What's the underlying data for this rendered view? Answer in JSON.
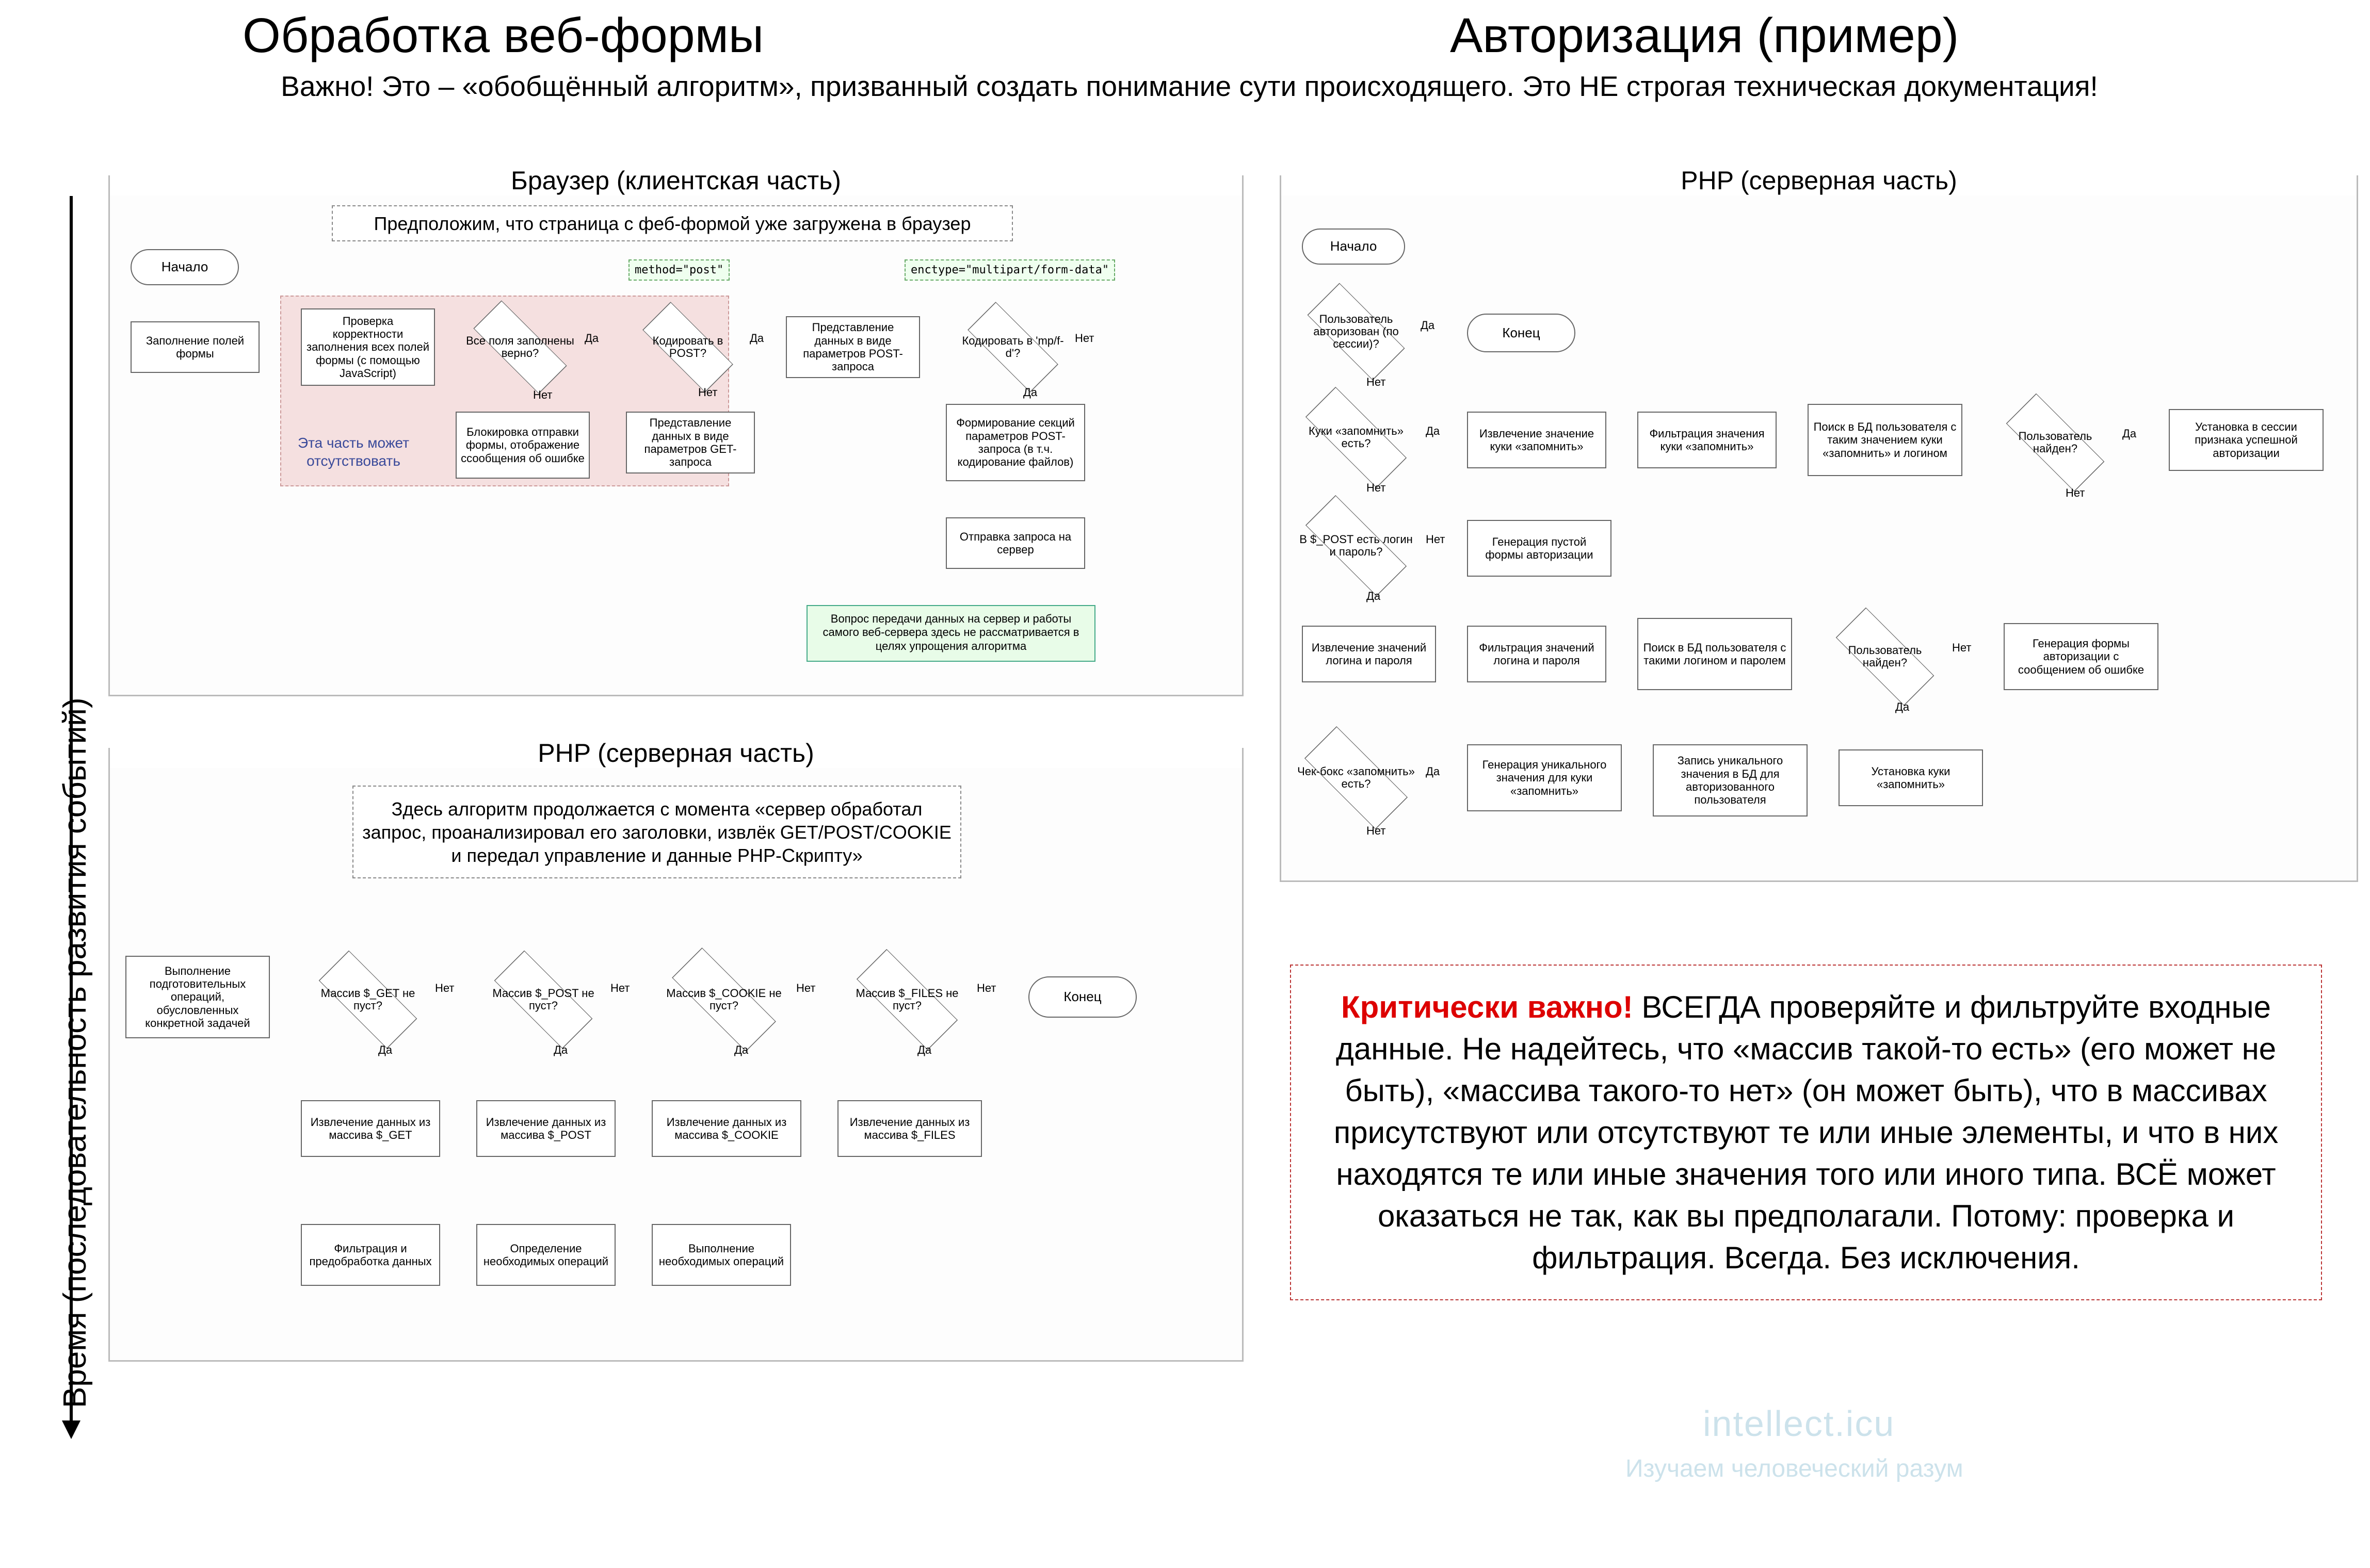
{
  "titles": {
    "left": "Обработка веб-формы",
    "right": "Авторизация (пример)",
    "subtitle": "Важно! Это – «обобщённый алгоритм», призванный создать понимание сути происходящего. Это НЕ строгая техническая документация!",
    "time_axis": "Время (последовательность развития событий)"
  },
  "sections": {
    "browser": "Браузер (клиентская часть)",
    "php_generic": "PHP (серверная часть)",
    "php_auth": "PHP (серверная часть)"
  },
  "labels": {
    "yes": "Да",
    "no": "Нет"
  },
  "browser": {
    "assumption": "Предположим, что страница с феб-формой уже загружена в браузер",
    "start": "Начало",
    "fill_fields": "Заполнение полей формы",
    "optional_note": "Эта часть может отсутствовать",
    "validate_js": "Проверка корректности заполнения всех полей формы (с помощью JavaScript)",
    "all_valid": "Все поля заполнены верно?",
    "block_submit": "Блокировка отправки формы, отображение ссообщения об ошибке",
    "encode_post_q": "Кодировать в POST?",
    "method_post": "method=\"post\"",
    "get_params": "Представление данных в виде параметров GET-запроса",
    "post_params": "Представление данных в виде параметров POST-запроса",
    "encode_mpfd_q": "Кодировать в 'mp/f-d'?",
    "enctype": "enctype=\"multipart/form-data\"",
    "form_mp_sections": "Формирование секций параметров POST-запроса (в т.ч. кодирование файлов)",
    "send_request": "Отправка запроса на сервер",
    "server_note": "Вопрос передачи данных на сервер и работы самого веб-сервера здесь не рассматривается в целях упрощения алгоритма"
  },
  "php_generic": {
    "continuation": "Здесь алгоритм продолжается с момента «сервер обработал запрос, проанализировал его заголовки, извлёк GET/POST/COOKIE и передал управление и данные PHP-Скрипту»",
    "prep_ops": "Выполнение подготовительных операций, обусловленных конкретной задачей",
    "get_not_empty": "Массив $_GET не пуст?",
    "post_not_empty": "Массив $_POST не пуст?",
    "cookie_not_empty": "Массив $_COOKIE не пуст?",
    "files_not_empty": "Массив $_FILES не пуст?",
    "extract_get": "Извлечение данных из массива $_GET",
    "extract_post": "Извлечение данных из массива $_POST",
    "extract_cookie": "Извлечение данных из массива $_COOKIE",
    "extract_files": "Извлечение данных из массива $_FILES",
    "filter_preprocess": "Фильтрация и предобработка данных",
    "determine_ops": "Определение необходимых операций",
    "execute_ops": "Выполнение необходимых операций",
    "end": "Конец"
  },
  "php_auth": {
    "start": "Начало",
    "end": "Конец",
    "user_authorized": "Пользователь авторизован (по сессии)?",
    "remember_cookie_exists": "Куки «запомнить» есть?",
    "extract_remember": "Извлечение значение куки «запомнить»",
    "filter_remember": "Фильтрация значения куки «запомнить»",
    "db_search_remember": "Поиск в БД пользователя с таким значением куки «запомнить» и логином",
    "user_found": "Пользователь найден?",
    "set_session_auth": "Установка в сессии признака успешной авторизации",
    "post_has_login": "В $_POST есть логин и пароль?",
    "gen_empty_form": "Генерация пустой формы авторизации",
    "extract_login": "Извлечение значений логина и пароля",
    "filter_login": "Фильтрация значений логина и пароля",
    "db_search_login": "Поиск в БД пользователя с такими логином и паролем",
    "user_found2": "Пользователь найден?",
    "gen_error_form": "Генерация формы авторизации с сообщением об ошибке",
    "remember_checkbox": "Чек-бокс «запомнить» есть?",
    "gen_unique_remember": "Генерация уникального значения для куки «запомнить»",
    "write_unique_db": "Запись уникального значения в БД для авторизованного пользователя",
    "set_remember_cookie": "Установка куки «запомнить»"
  },
  "warning": {
    "prefix": "Критически важно!",
    "body": " ВСЕГДА проверяйте и фильтруйте входные данные. Не надейтесь, что «массив такой-то есть» (его может не быть), «массива такого-то нет» (он может быть), что в массивах присутствуют или отсутствуют те или иные элементы, и что в них находятся те или иные значения того или иного типа. ВСЁ может оказаться не так, как вы предполагали. Потому: проверка и фильтрация. Всегда. Без исключения."
  },
  "watermark": {
    "main": "intellect.icu",
    "sub": "Изучаем человеческий разум"
  }
}
